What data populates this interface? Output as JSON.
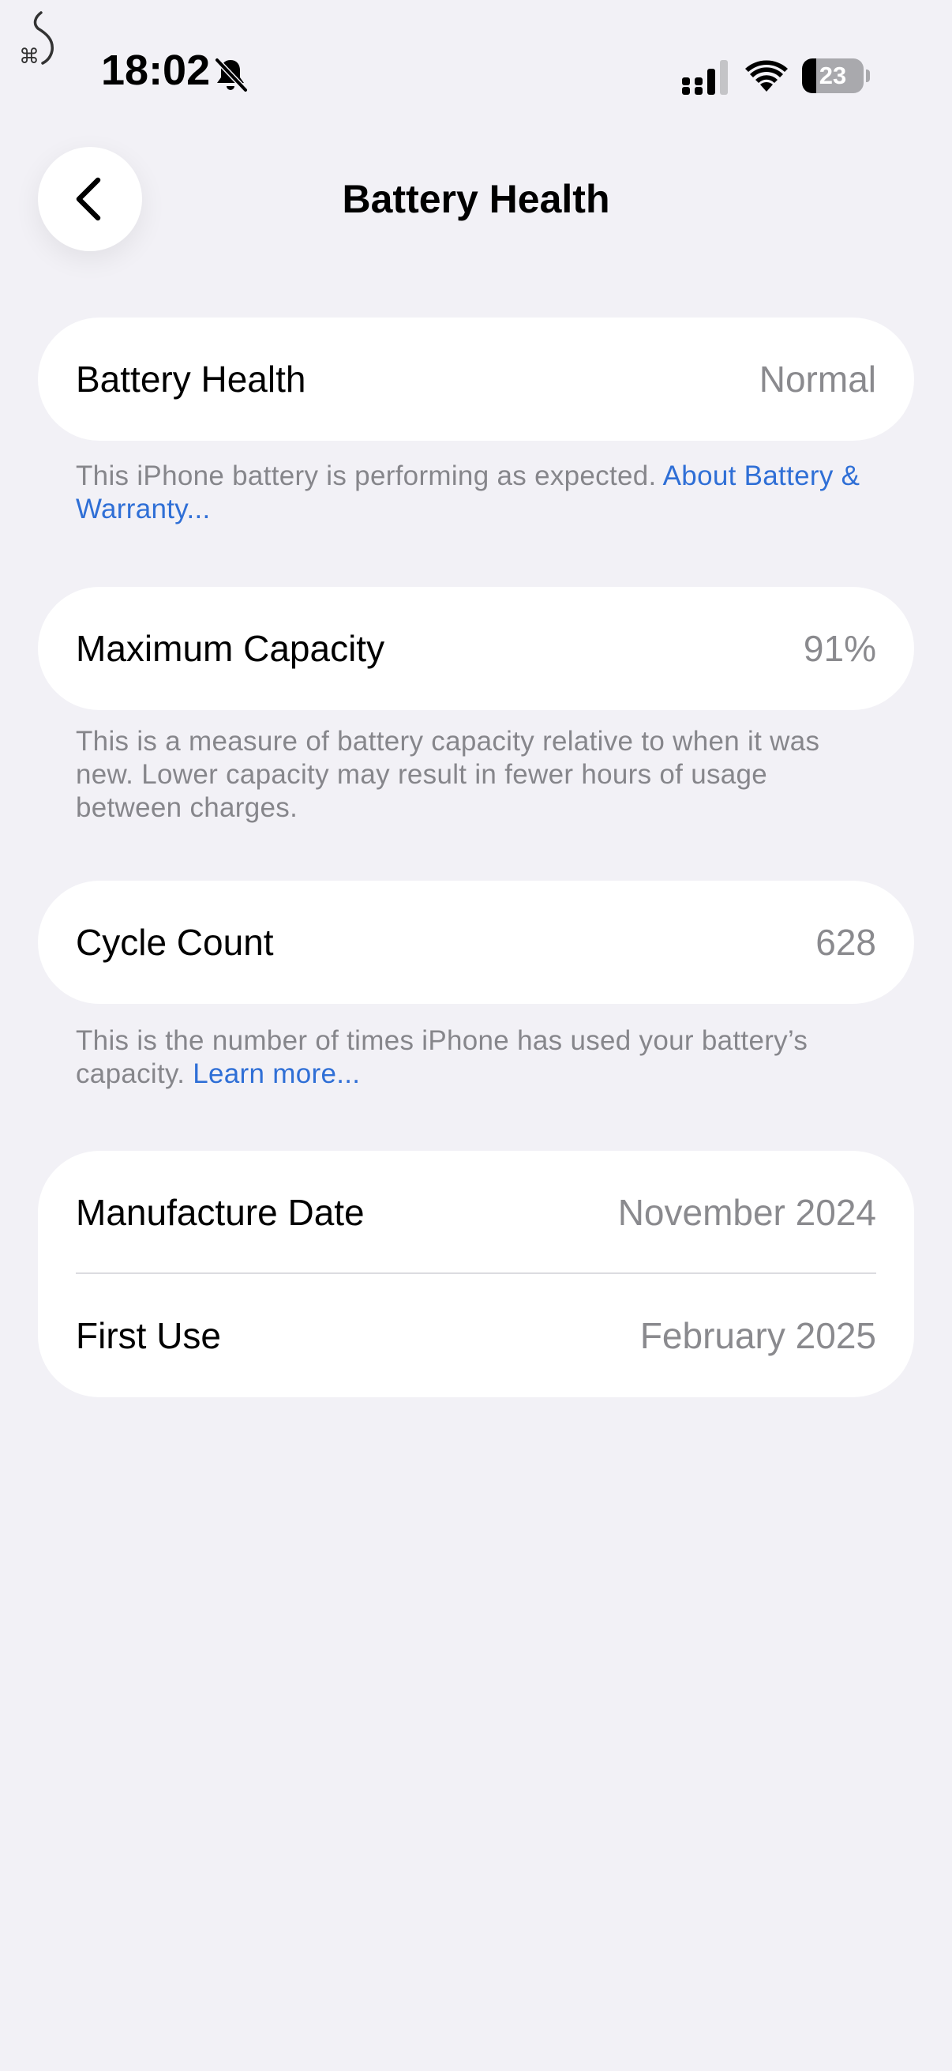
{
  "status_bar": {
    "time": "18:02",
    "battery_level": "23",
    "battery_fraction": 0.23,
    "icons": [
      "corner-glyph-icon",
      "bell-slash-icon",
      "cellular-signal-icon",
      "wifi-icon",
      "battery-icon"
    ]
  },
  "nav": {
    "title": "Battery Health",
    "back_icon": "chevron-left-icon"
  },
  "sections": {
    "health": {
      "label": "Battery Health",
      "value": "Normal",
      "footnote": "This iPhone battery is performing as expected. ",
      "footnote_link": "About Battery & Warranty..."
    },
    "capacity": {
      "label": "Maximum Capacity",
      "value": "91%",
      "footnote": "This is a measure of battery capacity relative to when it was new. Lower capacity may result in fewer hours of usage between charges."
    },
    "cycles": {
      "label": "Cycle Count",
      "value": "628",
      "footnote": "This is the number of times iPhone has used your battery’s capacity. ",
      "footnote_link": "Learn more..."
    },
    "dates": {
      "manufacture_label": "Manufacture Date",
      "manufacture_value": "November 2024",
      "first_use_label": "First Use",
      "first_use_value": "February 2025"
    }
  },
  "colors": {
    "background": "#f2f1f6",
    "card": "#ffffff",
    "link": "#2f6fd6",
    "secondary_text": "#8a8a8e"
  }
}
